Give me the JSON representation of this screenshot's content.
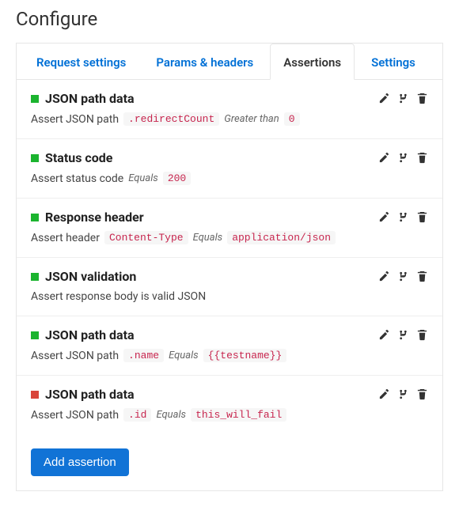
{
  "page_title": "Configure",
  "tabs": [
    {
      "label": "Request settings",
      "active": false
    },
    {
      "label": "Params & headers",
      "active": false
    },
    {
      "label": "Assertions",
      "active": true
    },
    {
      "label": "Settings",
      "active": false
    }
  ],
  "assertions": [
    {
      "status": "green",
      "title": "JSON path data",
      "desc_prefix": "Assert JSON path",
      "path": ".redirectCount",
      "operator": "Greater than",
      "value": "0"
    },
    {
      "status": "green",
      "title": "Status code",
      "desc_prefix": "Assert status code",
      "path": null,
      "operator": "Equals",
      "value": "200"
    },
    {
      "status": "green",
      "title": "Response header",
      "desc_prefix": "Assert header",
      "path": "Content-Type",
      "operator": "Equals",
      "value": "application/json"
    },
    {
      "status": "green",
      "title": "JSON validation",
      "desc_prefix": "Assert response body is valid JSON",
      "path": null,
      "operator": null,
      "value": null
    },
    {
      "status": "green",
      "title": "JSON path data",
      "desc_prefix": "Assert JSON path",
      "path": ".name",
      "operator": "Equals",
      "value": "{{testname}}"
    },
    {
      "status": "red",
      "title": "JSON path data",
      "desc_prefix": "Assert JSON path",
      "path": ".id",
      "operator": "Equals",
      "value": "this_will_fail"
    }
  ],
  "add_button_label": "Add assertion"
}
